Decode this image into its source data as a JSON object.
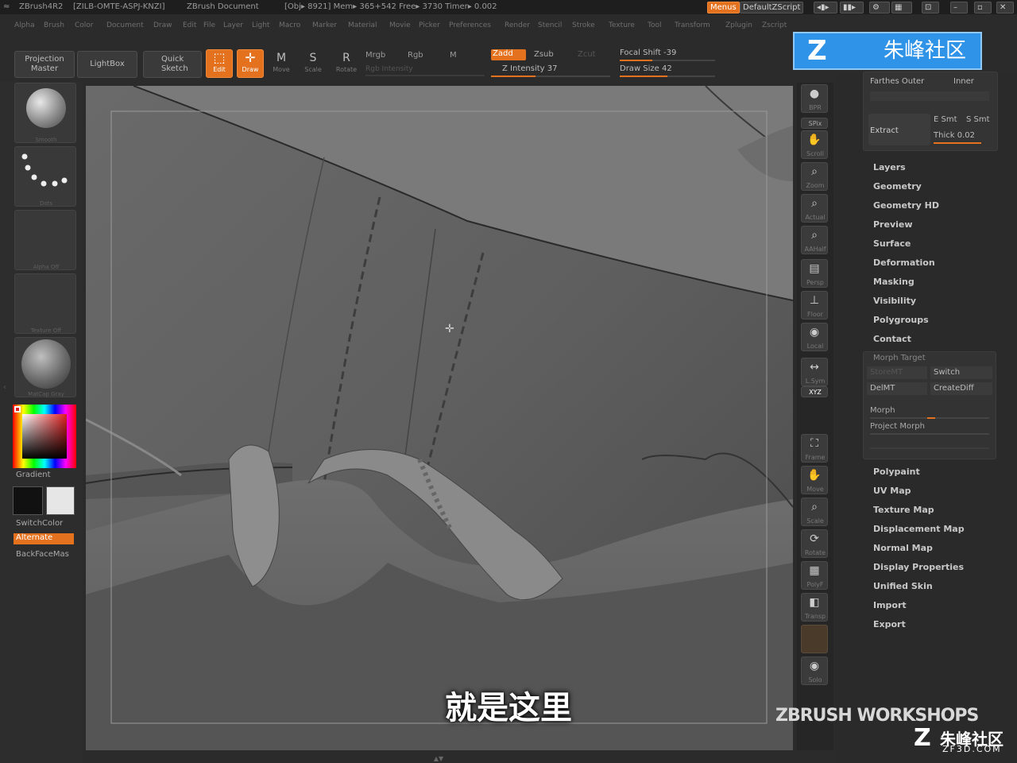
{
  "title_bar": {
    "app": "ZBrush4R2",
    "license": "[ZILB-OMTE-ASPJ-KNZI]",
    "document": "ZBrush Document",
    "stats": "[Obj▸ 8921] Mem▸ 365+542  Free▸ 3730  Timer▸ 0.002",
    "menus_button": "Menus",
    "script": "DefaultZScript"
  },
  "menu_bar": [
    "Alpha",
    "Brush",
    "Color",
    "Document",
    "Draw",
    "Edit",
    "File",
    "Layer",
    "Light",
    "Macro",
    "Marker",
    "Material",
    "Movie",
    "Picker",
    "Preferences",
    "Render",
    "Stencil",
    "Stroke",
    "Texture",
    "Tool",
    "Transform",
    "Zplugin",
    "Zscript"
  ],
  "toolbar": {
    "projection_master": "Projection Master",
    "lightbox": "LightBox",
    "quick_sketch": "Quick Sketch",
    "edit": "Edit",
    "draw": "Draw",
    "move": "Move",
    "scale": "Scale",
    "rotate": "Rotate",
    "mrgb": "Mrgb",
    "rgb": "Rgb",
    "m": "M",
    "rgb_intensity": "Rgb Intensity",
    "zadd": "Zadd",
    "zsub": "Zsub",
    "zcut": "Zcut",
    "z_intensity": "Z Intensity 37",
    "focal_shift": "Focal Shift -39",
    "draw_size": "Draw Size 42"
  },
  "left_panel": {
    "slots": [
      "Smooth",
      "Dots",
      "Alpha Off",
      "Texture Off",
      "MatCap Gray"
    ],
    "gradient": "Gradient",
    "switch_color": "SwitchColor",
    "alternate": "Alternate",
    "backface": "BackFaceMas"
  },
  "right_shelf": [
    "BPR",
    "SPix",
    "Scroll",
    "Zoom",
    "Actual",
    "AAHalf",
    "Persp",
    "Floor",
    "Local",
    "L.Sym",
    "XYZ",
    "Frame",
    "Move",
    "Scale",
    "Rotate",
    "PolyF",
    "Transp",
    "Solo"
  ],
  "tray": {
    "farthest": "Farthes Outer",
    "inner": "Inner",
    "extract": "Extract",
    "e_smt": "E Smt",
    "s_smt": "S Smt",
    "thick": "Thick 0.02",
    "items_top": [
      "Layers",
      "Geometry",
      "Geometry HD",
      "Preview",
      "Surface",
      "Deformation",
      "Masking",
      "Visibility",
      "Polygroups",
      "Contact"
    ],
    "morph_target": "Morph Target",
    "store_mt": "StoreMT",
    "switch": "Switch",
    "del_mt": "DelMT",
    "create_diff": "CreateDiff",
    "morph": "Morph",
    "project_morph": "Project Morph",
    "items_bottom": [
      "Polypaint",
      "UV Map",
      "Texture Map",
      "Displacement Map",
      "Normal Map",
      "Display Properties",
      "Unified Skin",
      "Import",
      "Export"
    ]
  },
  "watermark_top": "朱峰社区",
  "watermark_bottom_brand": "ZBRUSH WORKSHOPS",
  "watermark_bottom_cn": "朱峰社区",
  "watermark_bottom_url": "ZF3D.COM",
  "subtitle": "就是这里"
}
